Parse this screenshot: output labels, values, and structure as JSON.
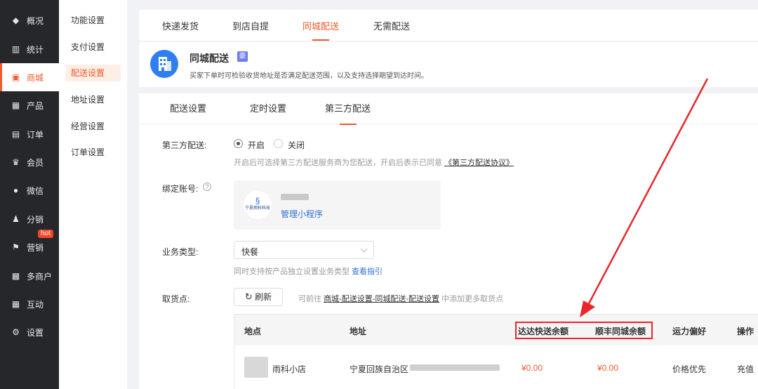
{
  "nav": {
    "items": [
      {
        "label": "概况",
        "icon": "layers-icon",
        "glyph": "◆"
      },
      {
        "label": "统计",
        "icon": "chart-icon",
        "glyph": "▥"
      },
      {
        "label": "商城",
        "icon": "shop-icon",
        "glyph": "▣"
      },
      {
        "label": "产品",
        "icon": "grid-icon",
        "glyph": "▦"
      },
      {
        "label": "订单",
        "icon": "clipboard-icon",
        "glyph": "▤"
      },
      {
        "label": "会员",
        "icon": "crown-icon",
        "glyph": "♛"
      },
      {
        "label": "微信",
        "icon": "wechat-icon",
        "glyph": "●"
      },
      {
        "label": "分销",
        "icon": "users-icon",
        "glyph": "♟"
      },
      {
        "label": "营销",
        "icon": "flag-icon",
        "glyph": "⚑",
        "badge": "hot"
      },
      {
        "label": "多商户",
        "icon": "store-icon",
        "glyph": "▩"
      },
      {
        "label": "互动",
        "icon": "interact-icon",
        "glyph": "▦"
      },
      {
        "label": "设置",
        "icon": "gear-icon",
        "glyph": "⚙"
      }
    ]
  },
  "subnav": {
    "items": [
      "功能设置",
      "支付设置",
      "配送设置",
      "地址设置",
      "经营设置",
      "订单设置"
    ]
  },
  "tabs": [
    "快递发货",
    "到店自提",
    "同城配送",
    "无需配送"
  ],
  "header": {
    "title": "同城配送",
    "tag": "豪",
    "desc": "买家下单时可检验收货地址是否满足配送范围，以及支持选择期望到达时间。"
  },
  "subtabs": [
    "配送设置",
    "定时设置",
    "第三方配送"
  ],
  "form": {
    "third_party_label": "第三方配送:",
    "opt_on": "开启",
    "opt_off": "关闭",
    "third_party_hint": "开启后可选择第三方配送服务商为您配送，开启后表示已同意",
    "agreement_link": "《第三方配送协议》",
    "bind_label": "绑定账号:",
    "help_icon": "?",
    "logo_text": "宁夏雨科科技",
    "manage_link": "管理小程序",
    "biz_label": "业务类型:",
    "biz_value": "快餐",
    "biz_hint": "同时支持按产品独立设置业务类型",
    "biz_guide": "查看指引",
    "pickup_label": "取货点:",
    "refresh_icon": "↻",
    "refresh_label": "刷新",
    "pickup_hint_pre": "可前往",
    "pickup_hint_link": "商城-配送设置-同城配送-配送设置",
    "pickup_hint_post": "中添加更多取货点"
  },
  "table": {
    "headers": [
      "地点",
      "地址",
      "达达快送余额",
      "顺丰同城余额",
      "运力偏好",
      "操作"
    ],
    "rows": [
      {
        "place": "雨科小店",
        "address": "宁夏回族自治区",
        "dada": "¥0.00",
        "sf": "¥0.00",
        "pref": "价格优先",
        "action": "充值"
      }
    ]
  },
  "colors": {
    "accent": "#f05a2b",
    "highlight": "#e8262a",
    "link": "#2f6fd6"
  }
}
